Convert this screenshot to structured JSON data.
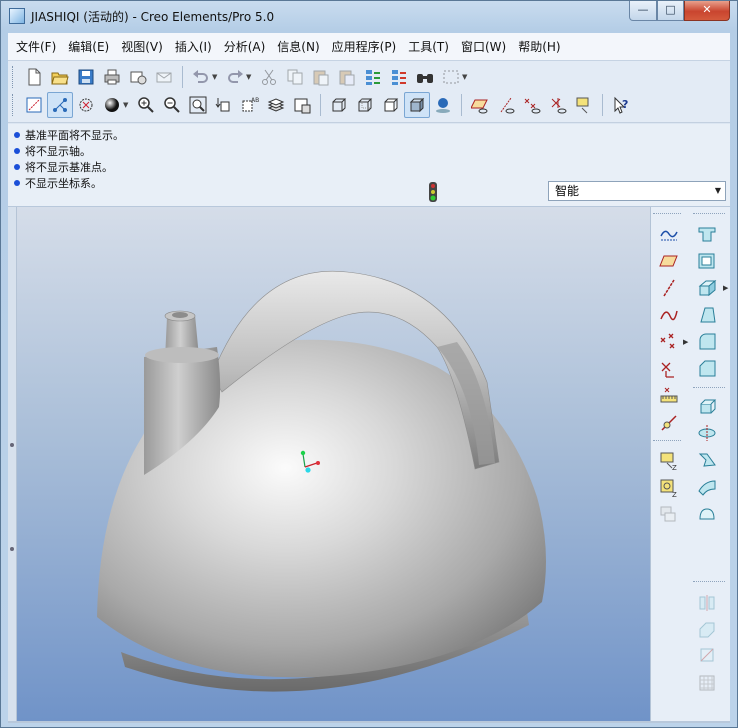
{
  "window": {
    "title": "JIASHIQI (活动的) - Creo Elements/Pro 5.0",
    "minimize_glyph": "—",
    "maximize_glyph": "□",
    "close_glyph": "✕"
  },
  "menubar": {
    "items": [
      "文件(F)",
      "编辑(E)",
      "视图(V)",
      "插入(I)",
      "分析(A)",
      "信息(N)",
      "应用程序(P)",
      "工具(T)",
      "窗口(W)",
      "帮助(H)"
    ]
  },
  "toolbar_icons": {
    "row1": [
      "new-file-icon",
      "open-folder-icon",
      "save-icon",
      "print-icon",
      "send-mail-icon",
      "mail-icon",
      "undo-icon",
      "redo-icon",
      "cut-icon",
      "copy-icon",
      "paste-icon",
      "paste-special-icon",
      "regenerate-icon",
      "regen-manager-icon",
      "find-icon",
      "select-box-icon"
    ],
    "row2": [
      "datum-plane-display-icon",
      "datum-axis-display-icon",
      "datum-point-display-icon",
      "shading-sphere-icon",
      "zoom-in-icon",
      "zoom-out-icon",
      "refit-icon",
      "reorient-icon",
      "saved-views-icon",
      "layers-icon",
      "view-manager-icon",
      "wireframe-icon",
      "hidden-line-icon",
      "no-hidden-icon",
      "shaded-icon",
      "enhanced-realism-icon",
      "plane-display-icon",
      "axis-display-icon",
      "point-display-icon",
      "csys-display-icon",
      "annotation-display-icon",
      "context-help-icon"
    ]
  },
  "messages": [
    "基准平面将不显示。",
    "将不显示轴。",
    "将不显示基准点。",
    "不显示坐标系。"
  ],
  "filter": {
    "selected": "智能"
  },
  "colors": {
    "message_bullet": "#1a4fd8",
    "background_top": "#d5dde9",
    "background_bottom": "#7093c8",
    "model": "#b8b8b8"
  }
}
